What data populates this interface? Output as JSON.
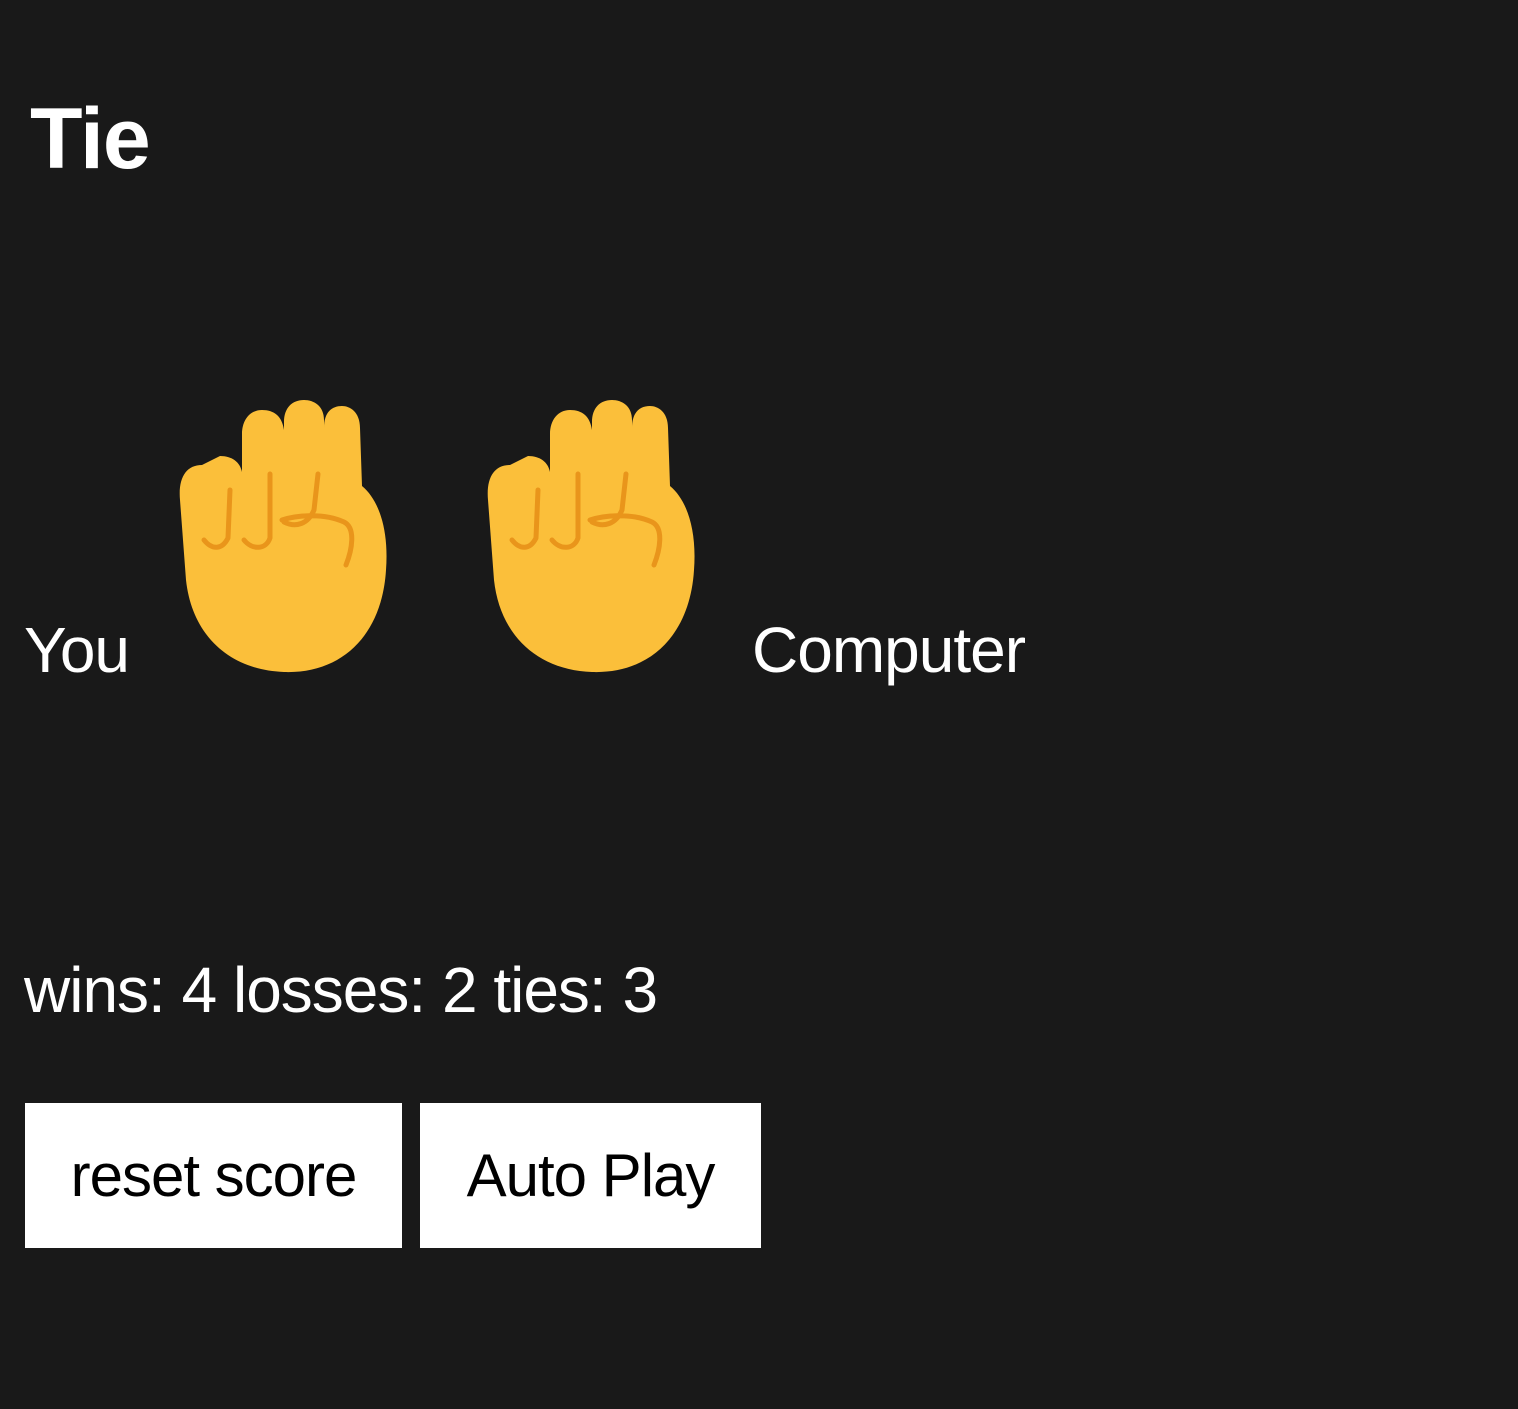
{
  "result": "Tie",
  "moves": {
    "player_label": "You",
    "computer_label": "Computer",
    "player_move_icon": "raised-fist-icon",
    "computer_move_icon": "raised-fist-icon"
  },
  "score": {
    "wins_label": "wins:",
    "wins": 4,
    "losses_label": "losses:",
    "losses": 2,
    "ties_label": "ties:",
    "ties": 3
  },
  "buttons": {
    "reset_label": "reset score",
    "auto_play_label": "Auto Play"
  },
  "colors": {
    "background": "#191919",
    "text": "#ffffff",
    "button_bg": "#ffffff",
    "button_text": "#000000",
    "fist_fill": "#FBBF3A",
    "fist_line": "#E9951B"
  }
}
